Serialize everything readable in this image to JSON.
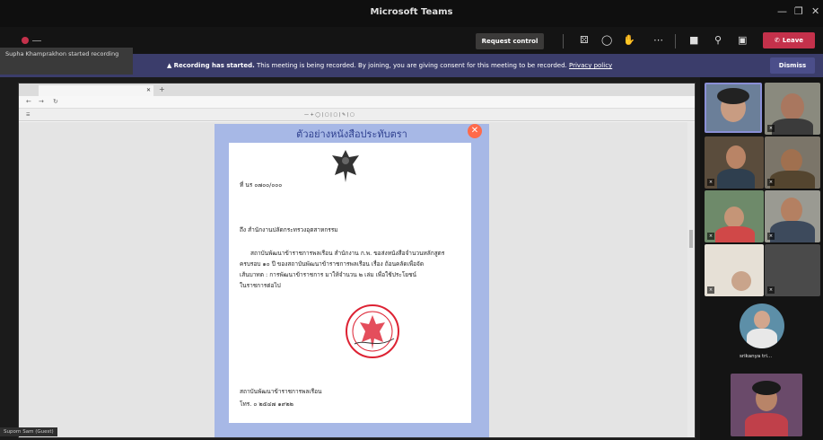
{
  "window": {
    "title": "Microsoft Teams"
  },
  "toolbar": {
    "request_control": "Request control",
    "leave": "Leave"
  },
  "notification": {
    "text": "Supha Khamprakhon started recording"
  },
  "banner": {
    "bold": "Recording has started.",
    "text": "This meeting is being recorded. By joining, you are giving consent for this meeting to be recorded.",
    "link": "Privacy policy",
    "dismiss": "Dismiss"
  },
  "document": {
    "title": "ตัวอย่างหนังสือประทับตรา",
    "line_ref": "ที่ นร ๐๗๐๐/๐๐๐",
    "line_to": "ถึง สำนักงานปลัดกระทรวงอุตสาหกรรม",
    "para1": "สถาบันพัฒนาข้าราชการพลเรือน สำนักงาน ก.พ. ขอส่งหนังสือจำนวนหลักสูตร",
    "para2": "ครบรอบ ๑๐ ปี ของสถาบันพัฒนาข้าราชการพลเรือน เรื่อง ถ้อนคลัดเพื่อจัด",
    "para3": "เส้นบาทต : การพัฒนาข้าราชการ มาให้จำนวน ๒ เล่ม เพื่อใช้ประโยชน์",
    "para4": "ในราชการต่อไป",
    "sign_org": "สถาบันพัฒนาข้าราชการพลเรือน",
    "sign_tel": "โทร. ๐ ๒๕๔๗ ๑๙๒๒"
  },
  "share_name": "Suporn Sam (Guest)",
  "participant_name": "srikanya tri...",
  "colors": {
    "leave": "#c4314b",
    "banner": "#3b3d6b",
    "doc_frame": "#a7b8e6"
  }
}
